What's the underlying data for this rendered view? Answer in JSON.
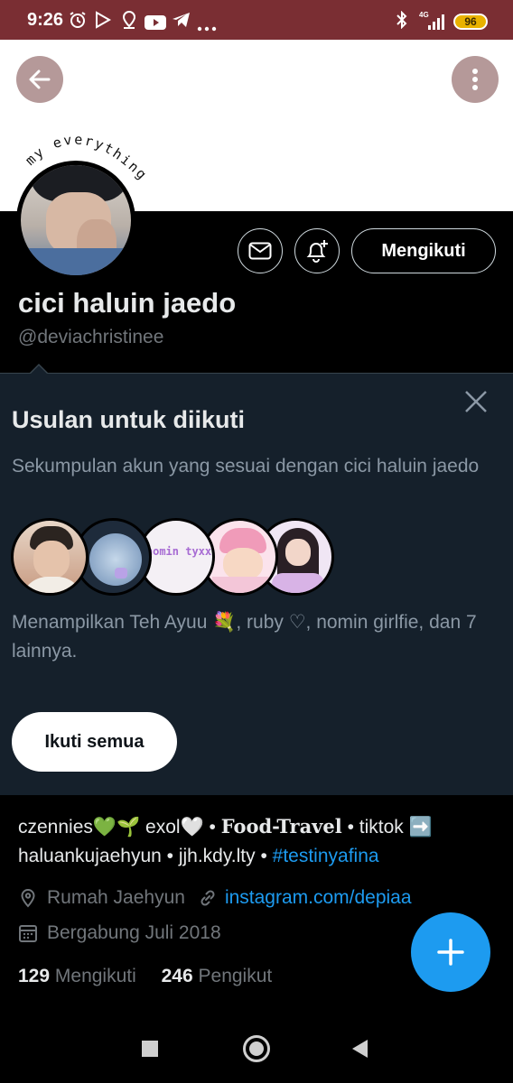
{
  "status_bar": {
    "time": "9:26",
    "network": "4G",
    "battery": "96"
  },
  "banner": {
    "caption": "my everything"
  },
  "header": {
    "follow_label": "Mengikuti"
  },
  "profile": {
    "display_name": "cici haluin jaedo",
    "handle": "@deviachristinee"
  },
  "suggestions": {
    "title": "Usulan untuk diikuti",
    "subtitle": "Sekumpulan akun yang sesuai dengan cici haluin jaedo",
    "showing": "Menampilkan Teh Ayuu 💐, ruby ♡, nomin girlfie, dan 7 lainnya.",
    "follow_all_label": "Ikuti semua",
    "avatar3_text": "nomin tyxx"
  },
  "bio": {
    "part1": "czennies💚🌱 exol🤍 • ",
    "part2": "Food-Travel",
    "part3": " • tiktok ➡️ haluankujaehyun • jjh.kdy.lty • ",
    "hashtag": "#testinyafina"
  },
  "meta": {
    "location": "Rumah Jaehyun",
    "website": "instagram.com/depiaa",
    "joined": "Bergabung Juli 2018"
  },
  "stats": {
    "following_count": "129",
    "following_label": "Mengikuti",
    "followers_count": "246",
    "followers_label": "Pengikut"
  },
  "colors": {
    "status_bar": "#7a2e33",
    "card_bg": "#15202b",
    "accent": "#1d9bf0",
    "muted": "#71767b"
  },
  "icons": [
    "alarm-icon",
    "play-store-icon",
    "maps-icon",
    "youtube-icon",
    "telegram-icon",
    "bluetooth-icon",
    "signal-icon",
    "back-arrow-icon",
    "more-vertical-icon",
    "mail-icon",
    "bell-plus-icon",
    "close-icon",
    "location-icon",
    "link-icon",
    "calendar-icon",
    "plus-icon"
  ]
}
